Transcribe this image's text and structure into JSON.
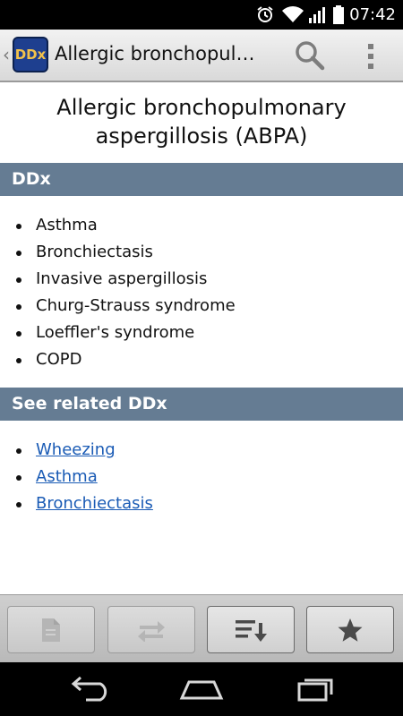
{
  "status_bar": {
    "time": "07:42",
    "icons": [
      "alarm-icon",
      "wifi-icon",
      "signal-icon",
      "battery-icon"
    ]
  },
  "action_bar": {
    "app_icon_text": "DDx",
    "title": "Allergic bronchopulmonary aspergillosis (ABPA)"
  },
  "page": {
    "title": "Allergic bronchopulmonary aspergillosis (ABPA)"
  },
  "ddx_section": {
    "header": "DDx",
    "items": [
      "Asthma",
      "Bronchiectasis",
      "Invasive aspergillosis",
      "Churg-Strauss syndrome",
      "Loeffler's syndrome",
      "COPD"
    ]
  },
  "related_section": {
    "header": "See related DDx",
    "links": [
      "Wheezing",
      "Asthma",
      "Bronchiectasis"
    ]
  },
  "toolbar": {
    "buttons": [
      {
        "icon": "document-icon",
        "enabled": false
      },
      {
        "icon": "swap-arrows-icon",
        "enabled": false
      },
      {
        "icon": "sort-list-icon",
        "enabled": true
      },
      {
        "icon": "star-icon",
        "enabled": true
      }
    ]
  },
  "navigation_bar": {
    "buttons": [
      "back-icon",
      "home-icon",
      "recents-icon"
    ]
  },
  "colors": {
    "section_header": "#657c93",
    "link": "#1a5bb5",
    "status_bar": "#000000",
    "logo_bg": "#1e3f8f",
    "logo_text": "#f2c24b"
  }
}
